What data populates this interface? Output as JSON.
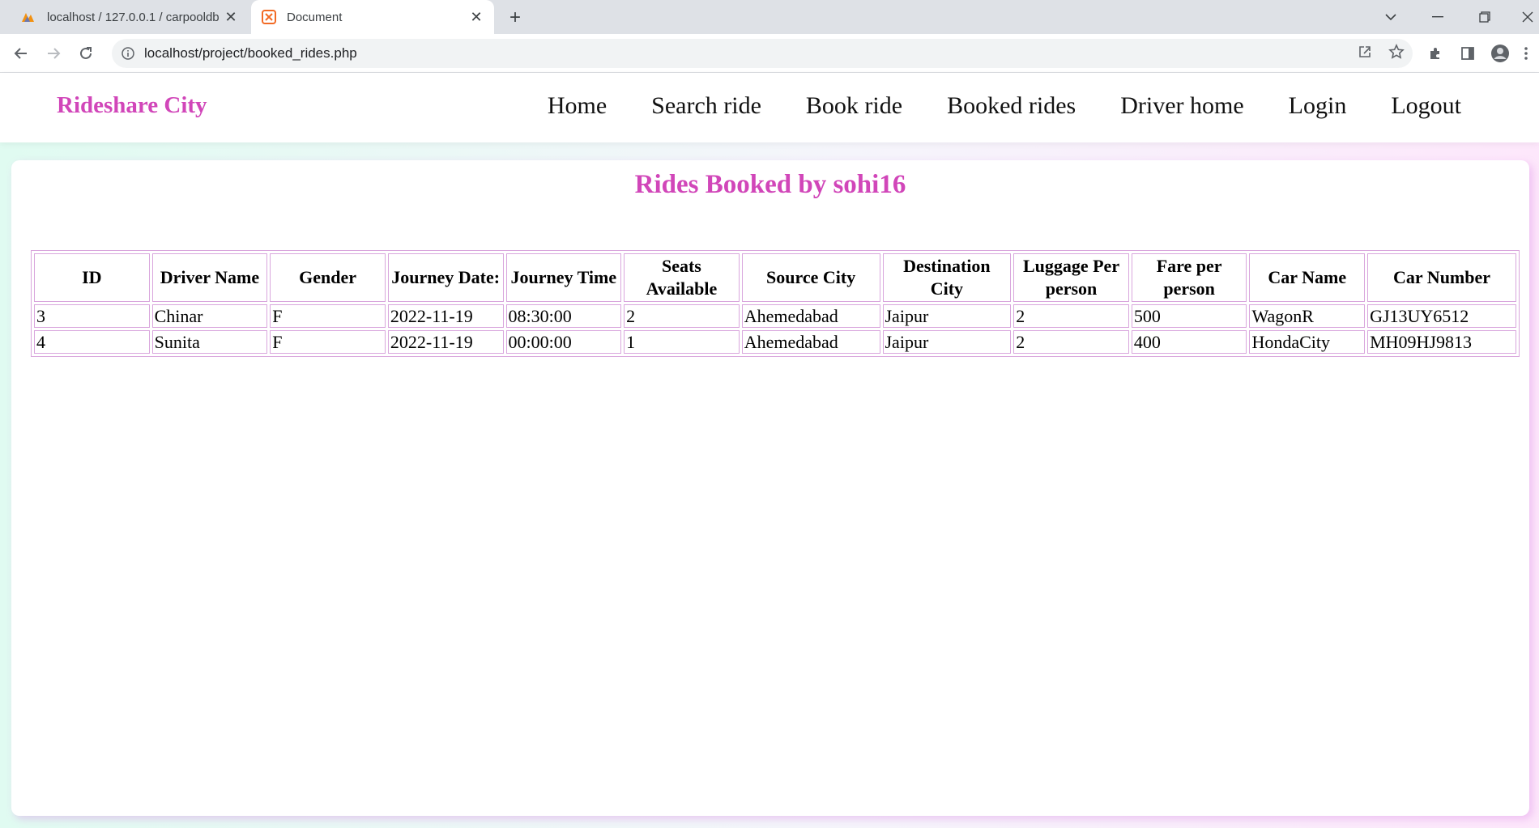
{
  "browser": {
    "tabs": [
      {
        "title": "localhost / 127.0.0.1 / carpooldb",
        "active": false,
        "icon": "phpmyadmin-icon"
      },
      {
        "title": "Document",
        "active": true,
        "icon": "xampp-icon"
      }
    ],
    "url": "localhost/project/booked_rides.php"
  },
  "site": {
    "brand": "Rideshare City",
    "brand_color": "#d146b9",
    "nav": [
      "Home",
      "Search ride",
      "Book ride",
      "Booked rides",
      "Driver home",
      "Login",
      "Logout"
    ]
  },
  "main": {
    "heading": "Rides Booked by sohi16",
    "table": {
      "headers": [
        "ID",
        "Driver Name",
        "Gender",
        "Journey Date:",
        "Journey Time",
        "Seats Available",
        "Source City",
        "Destination City",
        "Luggage Per person",
        "Fare per person",
        "Car Name",
        "Car Number"
      ],
      "rows": [
        [
          "3",
          "Chinar",
          "F",
          "2022-11-19",
          "08:30:00",
          "2",
          "Ahemedabad",
          "Jaipur",
          "2",
          "500",
          "WagonR",
          "GJ13UY6512"
        ],
        [
          "4",
          "Sunita",
          "F",
          "2022-11-19",
          "00:00:00",
          "1",
          "Ahemedabad",
          "Jaipur",
          "2",
          "400",
          "HondaCity",
          "MH09HJ9813"
        ]
      ]
    }
  }
}
